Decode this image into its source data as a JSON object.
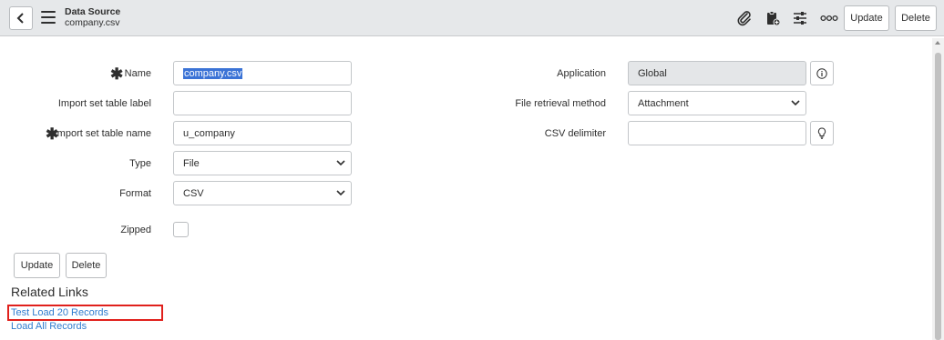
{
  "header": {
    "title": "Data Source",
    "subtitle": "company.csv",
    "update_label": "Update",
    "delete_label": "Delete",
    "icons": [
      "back-icon",
      "menu-icon",
      "paperclip-icon",
      "clipboard-add-icon",
      "sliders-icon",
      "more-icon"
    ]
  },
  "form": {
    "name": {
      "label": "Name",
      "value": "company.csv",
      "required": true
    },
    "import_set_table_label": {
      "label": "Import set table label",
      "value": ""
    },
    "import_set_table_name": {
      "label": "Import set table name",
      "value": "u_company",
      "required": true
    },
    "type": {
      "label": "Type",
      "value": "File"
    },
    "format": {
      "label": "Format",
      "value": "CSV"
    },
    "zipped": {
      "label": "Zipped",
      "checked": false
    },
    "application": {
      "label": "Application",
      "value": "Global"
    },
    "file_retrieval_method": {
      "label": "File retrieval method",
      "value": "Attachment"
    },
    "csv_delimiter": {
      "label": "CSV delimiter",
      "value": ""
    }
  },
  "actions": {
    "update_label": "Update",
    "delete_label": "Delete"
  },
  "related_links": {
    "heading": "Related Links",
    "links": [
      "Test Load 20 Records",
      "Load All Records"
    ]
  },
  "colors": {
    "header_bg": "#e6e8ea",
    "link": "#2f7ccf",
    "selection": "#3b73d6",
    "highlight": "#e0201c"
  }
}
